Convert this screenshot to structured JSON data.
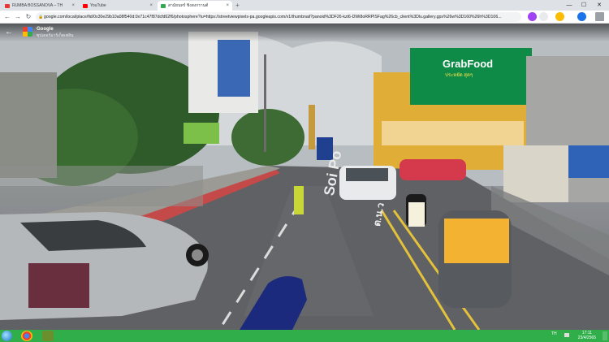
{
  "browser": {
    "tabs": [
      {
        "label": "RUMBA BOSSANOVA – THAI",
        "favicon_color": "#e53935",
        "active": false
      },
      {
        "label": "YouTube",
        "favicon_color": "#ff0000",
        "active": false
      },
      {
        "label": "สามัยนทร์ ชิงสงกรานต์",
        "favicon_color": "#34a853",
        "active": true
      }
    ],
    "new_tab": "+",
    "window_controls": {
      "minimize": "—",
      "maximize": "☐",
      "close": "✕"
    },
    "toolbar": {
      "back": "←",
      "forward": "→",
      "reload": "↻",
      "url": "google.com/local/place/fid/0x30e29b10a08f540d:0x71c47f87dcfd62f6/photosphere?iu=https://streetviewpixels-pa.googleapis.com/v1/thumbnail?panoid%3DF26-kzt6-DWi8oRRPlSFag%26cb_client%3Dlu.gallery.gps%26w%3D160%26h%3D106...",
      "extension_colors": [
        "#a142f4",
        "#e8eaed",
        "#fbbc04",
        "#1a73e8",
        "#9aa0a6"
      ]
    }
  },
  "street_view": {
    "back": "←",
    "title": "Google",
    "subtitle": "ซุปเดอร์มาร์เก็ตเพลิน",
    "billboard_brand": "GrabFood",
    "billboard_line": "ประหยัด สุดๆ",
    "road_text": "Soi Po",
    "road_text_thai": "ต.น.ว"
  },
  "taskbar": {
    "language": "TH",
    "time": "17:11",
    "date": "23/4/2565",
    "icons": [
      "chrome",
      "app"
    ]
  }
}
